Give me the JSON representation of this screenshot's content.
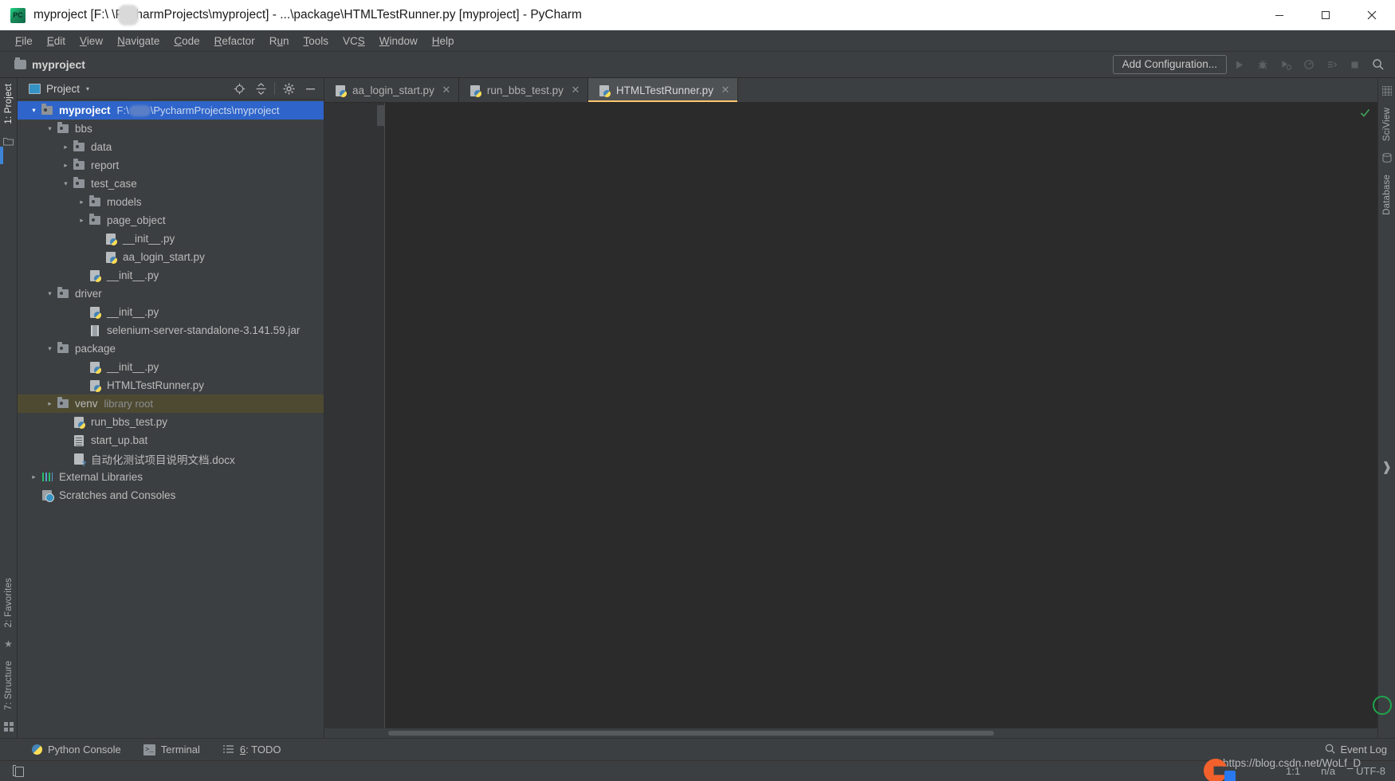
{
  "window": {
    "app_icon": "pycharm-logo-icon",
    "title": "myproject [F:\\    \\PycharmProjects\\myproject] - ...\\package\\HTMLTestRunner.py [myproject] - PyCharm",
    "minimize_glyph": "—",
    "maximize_glyph": "☐",
    "close_glyph": "✕",
    "titlebar_bg": "#ffffff"
  },
  "menubar": {
    "items": [
      {
        "label": "File",
        "mnemonic": "F"
      },
      {
        "label": "Edit",
        "mnemonic": "E"
      },
      {
        "label": "View",
        "mnemonic": "V"
      },
      {
        "label": "Navigate",
        "mnemonic": "N"
      },
      {
        "label": "Code",
        "mnemonic": "C"
      },
      {
        "label": "Refactor",
        "mnemonic": "R"
      },
      {
        "label": "Run",
        "mnemonic": "u"
      },
      {
        "label": "Tools",
        "mnemonic": "T"
      },
      {
        "label": "VCS",
        "mnemonic": "S"
      },
      {
        "label": "Window",
        "mnemonic": "W"
      },
      {
        "label": "Help",
        "mnemonic": "H"
      }
    ]
  },
  "navbar": {
    "breadcrumb": "myproject",
    "add_configuration_label": "Add Configuration...",
    "icons": [
      "run-icon",
      "debug-icon",
      "run-with-coverage-icon",
      "profile-icon",
      "attach-icon",
      "stop-icon",
      "search-everywhere-icon"
    ]
  },
  "left_strip": {
    "project_tab": {
      "label": "1: Project",
      "mnemonic": "1",
      "active": true
    },
    "favorites_tab": {
      "label": "2: Favorites",
      "mnemonic": "2"
    },
    "structure_tab": {
      "label": "7: Structure",
      "mnemonic": "7"
    },
    "icons": [
      "folder-icon",
      "star-icon",
      "grid-icon"
    ]
  },
  "right_strip": {
    "sciview_tab": "SciView",
    "database_tab": "Database",
    "icons": [
      "grid-icon",
      "database-icon",
      "expand-arrow-icon"
    ]
  },
  "project_panel": {
    "view_name": "Project",
    "caret_glyph": "▾",
    "actions": [
      "locate-icon",
      "collapse-all-icon",
      "settings-gear-icon",
      "hide-icon"
    ],
    "tree": [
      {
        "depth": 0,
        "arrow": "down",
        "icon": "folder-icon",
        "name": "myproject",
        "bold": true,
        "path": "F:\\    \\PycharmProjects\\myproject",
        "state": "selected",
        "masked_path": true
      },
      {
        "depth": 1,
        "arrow": "down",
        "icon": "folder-icon",
        "name": "bbs"
      },
      {
        "depth": 2,
        "arrow": "right",
        "icon": "folder-icon",
        "name": "data"
      },
      {
        "depth": 2,
        "arrow": "right",
        "icon": "folder-icon",
        "name": "report"
      },
      {
        "depth": 2,
        "arrow": "down",
        "icon": "folder-icon",
        "name": "test_case"
      },
      {
        "depth": 3,
        "arrow": "right",
        "icon": "folder-icon",
        "name": "models"
      },
      {
        "depth": 3,
        "arrow": "right",
        "icon": "folder-icon",
        "name": "page_object"
      },
      {
        "depth": 4,
        "arrow": "none",
        "icon": "python-file-icon",
        "name": "__init__.py"
      },
      {
        "depth": 4,
        "arrow": "none",
        "icon": "python-file-icon",
        "name": "aa_login_start.py"
      },
      {
        "depth": 3,
        "arrow": "none",
        "icon": "python-file-icon",
        "name": "__init__.py"
      },
      {
        "depth": 1,
        "arrow": "down",
        "icon": "folder-icon",
        "name": "driver"
      },
      {
        "depth": 3,
        "arrow": "none",
        "icon": "python-file-icon",
        "name": "__init__.py"
      },
      {
        "depth": 3,
        "arrow": "none",
        "icon": "jar-file-icon",
        "name": "selenium-server-standalone-3.141.59.jar"
      },
      {
        "depth": 1,
        "arrow": "down",
        "icon": "folder-icon",
        "name": "package"
      },
      {
        "depth": 3,
        "arrow": "none",
        "icon": "python-file-icon",
        "name": "__init__.py"
      },
      {
        "depth": 3,
        "arrow": "none",
        "icon": "python-file-icon",
        "name": "HTMLTestRunner.py"
      },
      {
        "depth": 1,
        "arrow": "right",
        "icon": "folder-icon",
        "name": "venv",
        "hint": "library root",
        "state": "highlighted"
      },
      {
        "depth": 2,
        "arrow": "none",
        "icon": "python-file-icon",
        "name": "run_bbs_test.py"
      },
      {
        "depth": 2,
        "arrow": "none",
        "icon": "bat-file-icon",
        "name": "start_up.bat"
      },
      {
        "depth": 2,
        "arrow": "none",
        "icon": "docx-file-icon",
        "name": "自动化测试项目说明文档.docx"
      },
      {
        "depth": 0,
        "arrow": "right",
        "icon": "external-libraries-icon",
        "name": "External Libraries"
      },
      {
        "depth": 0,
        "arrow": "none",
        "icon": "scratches-icon",
        "name": "Scratches and Consoles"
      }
    ]
  },
  "editor": {
    "tabs": [
      {
        "label": "aa_login_start.py",
        "icon": "python-file-icon",
        "active": false,
        "close_glyph": "✕"
      },
      {
        "label": "run_bbs_test.py",
        "icon": "python-file-icon",
        "active": false,
        "close_glyph": "✕"
      },
      {
        "label": "HTMLTestRunner.py",
        "icon": "python-file-icon",
        "active": true,
        "close_glyph": "✕"
      }
    ],
    "content": "",
    "inspection_status": "ok-check-icon",
    "active_tab_underline_color": "#ffc66d",
    "code_background": "#2b2b2b"
  },
  "bottom_strip": {
    "items": [
      {
        "label": "Python Console",
        "icon": "python-console-icon"
      },
      {
        "label": "Terminal",
        "icon": "terminal-icon"
      },
      {
        "label": "6: TODO",
        "icon": "todo-list-icon",
        "mnemonic": "6"
      }
    ],
    "event_log": {
      "label": "Event Log",
      "icon": "event-log-icon"
    }
  },
  "statusbar": {
    "toggle_icon": "toggle-sidebar-icon",
    "caret_position": "1:1",
    "line_separator": "n/a",
    "encoding": "UTF-8"
  },
  "watermark": {
    "url_text": "https://blog.csdn.net/WoLf_D",
    "logo": "csdn-logo-icon"
  }
}
